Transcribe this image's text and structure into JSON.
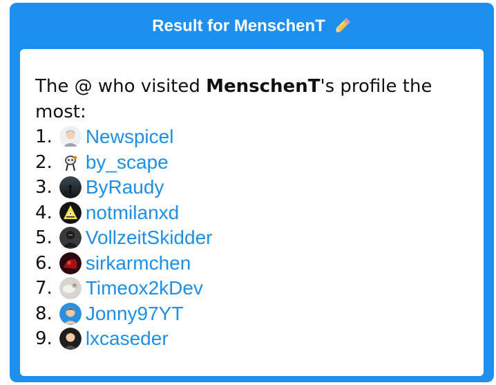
{
  "header": {
    "title": "Result for MenschenT",
    "icon": "pencil-icon"
  },
  "intro": {
    "prefix": "The @ who visited ",
    "username": "MenschenT",
    "suffix": "'s profile the most:"
  },
  "visitors": [
    {
      "rank": "1.",
      "name": "Newspicel",
      "avatar": "avatar-memoji-gray"
    },
    {
      "rank": "2.",
      "name": "by_scape",
      "avatar": "avatar-cartoon-character"
    },
    {
      "rank": "3.",
      "name": "ByRaudy",
      "avatar": "avatar-dark-landscape"
    },
    {
      "rank": "4.",
      "name": "notmilanxd",
      "avatar": "avatar-yellow-triangle"
    },
    {
      "rank": "5.",
      "name": "VollzeitSkidder",
      "avatar": "avatar-dark-figure"
    },
    {
      "rank": "6.",
      "name": "sirkarmchen",
      "avatar": "avatar-red-dark"
    },
    {
      "rank": "7.",
      "name": "Timeox2kDev",
      "avatar": "avatar-light-animal"
    },
    {
      "rank": "8.",
      "name": "Jonny97YT",
      "avatar": "avatar-blue-person"
    },
    {
      "rank": "9.",
      "name": "lxcaseder",
      "avatar": "avatar-memoji-dark"
    }
  ],
  "colors": {
    "accent": "#1d90ef",
    "link": "#1d8fe6",
    "text": "#111111"
  }
}
